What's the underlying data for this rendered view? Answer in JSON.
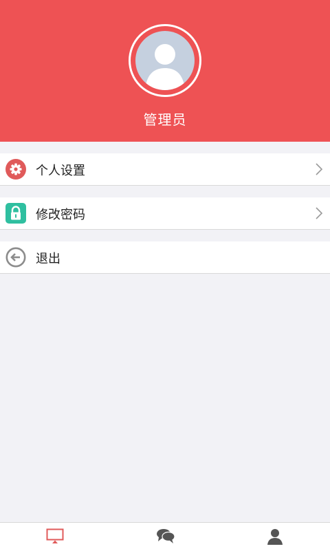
{
  "profile": {
    "username": "管理员"
  },
  "menu": {
    "items": [
      {
        "label": "个人设置",
        "icon": "settings-gear-icon",
        "icon_color": "#e05a5a"
      },
      {
        "label": "修改密码",
        "icon": "lock-icon",
        "icon_color": "#2fbfa0"
      },
      {
        "label": "退出",
        "icon": "back-arrow-icon",
        "icon_color": "#8c8c8c"
      }
    ]
  },
  "tabbar": {
    "tabs": [
      {
        "icon": "monitor-icon",
        "active": true,
        "color": "#e05a5a"
      },
      {
        "icon": "chat-bubbles-icon",
        "active": false,
        "color": "#555555"
      },
      {
        "icon": "user-icon",
        "active": false,
        "color": "#555555"
      }
    ]
  },
  "colors": {
    "header": "#ee5254",
    "background": "#f2f2f6"
  }
}
